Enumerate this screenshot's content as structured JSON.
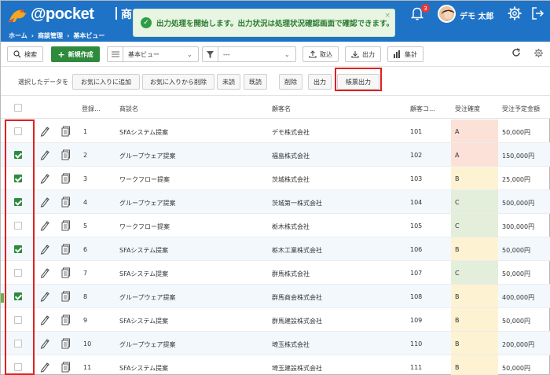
{
  "header": {
    "app_name": "@pocket",
    "page_title_fragment": "商",
    "breadcrumb": [
      "ホーム",
      "商談管理",
      "基本ビュー"
    ],
    "breadcrumb_sep": "›",
    "notification_count": "3",
    "user_name": "デモ 太郎",
    "colors": {
      "header_bg": "#1f73c6",
      "accent_green": "#2e8b3e",
      "highlight_red": "#e02020"
    }
  },
  "toast": {
    "message": "出力処理を開始します。出力状況は処理状況確認画面で確認できます。",
    "close": "×",
    "check": "✓"
  },
  "toolbar": {
    "search_label": "検索",
    "new_label": "新規作成",
    "view_select": "基本ビュー",
    "filter_select": "---",
    "import_label": "取込",
    "export_label": "出力",
    "aggregate_label": "集計"
  },
  "actionbar": {
    "selected_label": "選択したデータを",
    "buttons": [
      "お気に入りに追加",
      "お気に入りから削除",
      "未読",
      "既読",
      "削除",
      "出力",
      "帳票出力"
    ]
  },
  "table": {
    "headers": {
      "reg": "登録…",
      "deal": "商談名",
      "customer": "顧客名",
      "code": "顧客コ…",
      "prob": "受注確度",
      "amount": "受注予定金額"
    },
    "rows": [
      {
        "checked": false,
        "no": "1",
        "deal": "SFAシステム提案",
        "customer": "デモ株式会社",
        "code": "101",
        "prob": "A",
        "amount": "50,000円"
      },
      {
        "checked": true,
        "no": "2",
        "deal": "グループウェア提案",
        "customer": "福島株式会社",
        "code": "102",
        "prob": "A",
        "amount": "150,000円"
      },
      {
        "checked": true,
        "no": "3",
        "deal": "ワークフロー提案",
        "customer": "茨城株式会社",
        "code": "103",
        "prob": "B",
        "amount": "25,000円"
      },
      {
        "checked": true,
        "no": "4",
        "deal": "グループウェア提案",
        "customer": "茨城第一株式会社",
        "code": "104",
        "prob": "C",
        "amount": "500,000円"
      },
      {
        "checked": false,
        "no": "5",
        "deal": "ワークフロー提案",
        "customer": "栃木株式会社",
        "code": "105",
        "prob": "C",
        "amount": "300,000円"
      },
      {
        "checked": true,
        "no": "6",
        "deal": "SFAシステム提案",
        "customer": "栃木工業株式会社",
        "code": "106",
        "prob": "B",
        "amount": "50,000円"
      },
      {
        "checked": false,
        "no": "7",
        "deal": "SFAシステム提案",
        "customer": "群馬株式会社",
        "code": "107",
        "prob": "C",
        "amount": "50,000円"
      },
      {
        "checked": true,
        "no": "8",
        "deal": "グループウェア提案",
        "customer": "群馬商会株式会社",
        "code": "108",
        "prob": "B",
        "amount": "400,000円"
      },
      {
        "checked": false,
        "no": "9",
        "deal": "SFAシステム提案",
        "customer": "群馬建設株式会社",
        "code": "109",
        "prob": "B",
        "amount": "50,000円"
      },
      {
        "checked": false,
        "no": "10",
        "deal": "グループウェア提案",
        "customer": "埼玉株式会社",
        "code": "110",
        "prob": "B",
        "amount": "200,000円"
      },
      {
        "checked": false,
        "no": "11",
        "deal": "SFAシステム提案",
        "customer": "埼玉建設株式会社",
        "code": "111",
        "prob": "B",
        "amount": "50,000円"
      }
    ],
    "prob_colors": {
      "A": "#fbe1d8",
      "B": "#fdf2d2",
      "C": "#e3eedb"
    }
  }
}
